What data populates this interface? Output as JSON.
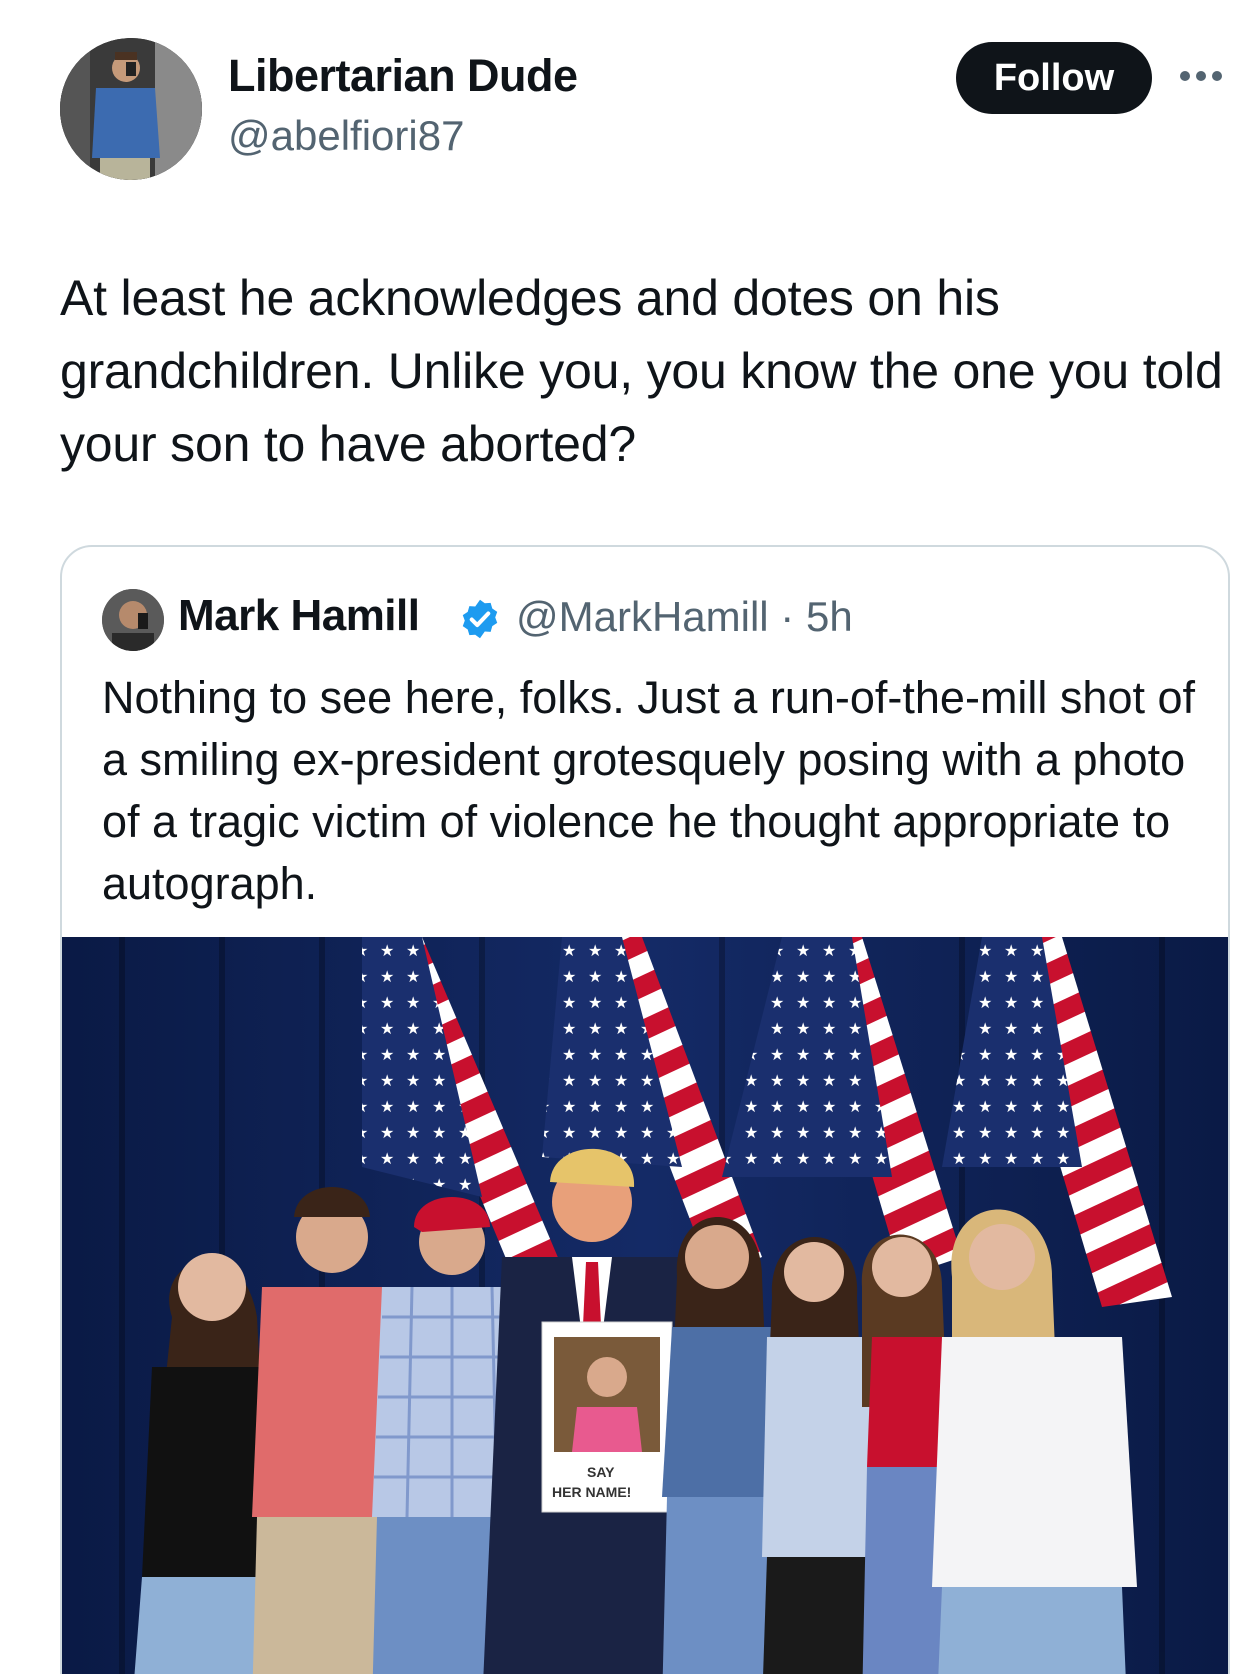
{
  "author": {
    "name": "Libertarian Dude",
    "handle": "@abelfiori87",
    "follow_label": "Follow",
    "more_icon": "more-horizontal-icon"
  },
  "tweet": {
    "text": "At least he acknowledges and dotes on his grandchildren. Unlike you, you know the one you told your son to have aborted?"
  },
  "quote": {
    "name": "Mark Hamill",
    "verified_icon": "verified-badge-icon",
    "handle_time": "@MarkHamill · 5h",
    "text": "Nothing to see here, folks. Just a run-of-the-mill shot of a smiling ex-president grotesquely posing with a photo of a tragic victim of violence he thought appropriate to autograph.",
    "image": {
      "sign_text_1": "SAY",
      "sign_text_2": "HER NAME!"
    }
  },
  "colors": {
    "text_primary": "#0f1419",
    "text_secondary": "#536471",
    "border": "#cfd9de",
    "verified": "#1d9bf0",
    "follow_bg": "#0f1419"
  }
}
